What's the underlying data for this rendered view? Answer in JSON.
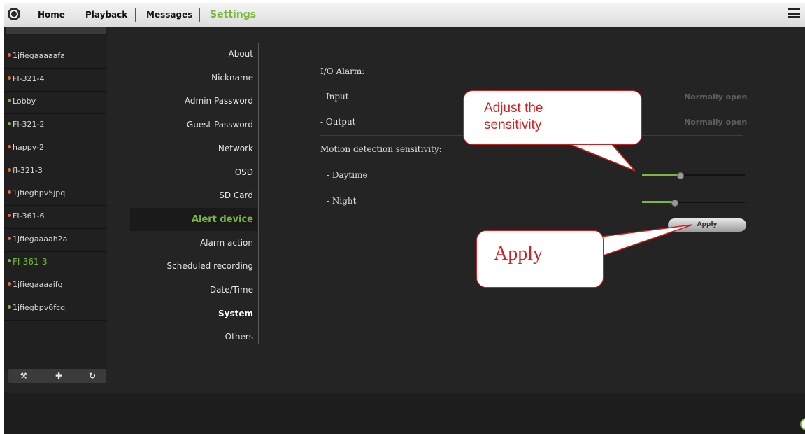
{
  "topbar": {
    "home": "Home",
    "playback": "Playback",
    "messages": "Messages",
    "settings": "Settings",
    "menu_icon": "hamburger-menu-icon"
  },
  "devices": [
    {
      "name": "1jfiegaaaaafa",
      "status": "offline"
    },
    {
      "name": "FI-321-4",
      "status": "offline"
    },
    {
      "name": "Lobby",
      "status": "online"
    },
    {
      "name": "FI-321-2",
      "status": "online"
    },
    {
      "name": "happy-2",
      "status": "offline"
    },
    {
      "name": "fl-321-3",
      "status": "offline"
    },
    {
      "name": "1jfiegbpv5jpq",
      "status": "offline"
    },
    {
      "name": "FI-361-6",
      "status": "offline"
    },
    {
      "name": "1jfiegaaaah2a",
      "status": "offline"
    },
    {
      "name": "FI-361-3",
      "status": "online",
      "selected": true
    },
    {
      "name": "1jfiegaaaaifq",
      "status": "offline"
    },
    {
      "name": "1jfiegbpv6fcq",
      "status": "online"
    }
  ],
  "device_toolbar": {
    "settings_icon": "wrench-icon",
    "add_icon": "plus-icon",
    "refresh_icon": "refresh-icon"
  },
  "settings_menu": [
    "About",
    "Nickname",
    "Admin Password",
    "Guest Password",
    "Network",
    "OSD",
    "SD Card",
    "Alert device",
    "Alarm action",
    "Scheduled recording",
    "Date/Time",
    "System",
    "Others"
  ],
  "settings_menu_active": "Alert device",
  "settings_menu_bold": "System",
  "content": {
    "io_alarm_label": "I/O Alarm:",
    "input_label": "- Input",
    "input_value": "Normally open",
    "output_label": "- Output",
    "output_value": "Normally open",
    "motion_label": "Motion detection sensitivity:",
    "daytime_label": "- Daytime",
    "daytime_level": 0.37,
    "night_label": "- Night",
    "night_level": 0.31,
    "apply_button": "Apply"
  },
  "callouts": {
    "sensitivity_line1": "Adjust the",
    "sensitivity_line2": "sensitivity",
    "apply_note": "Apply"
  },
  "colors": {
    "accent": "#7ab83c",
    "offline_dot": "#e8692a",
    "online_dot": "#7ab83c",
    "callout_text": "#d42020"
  }
}
